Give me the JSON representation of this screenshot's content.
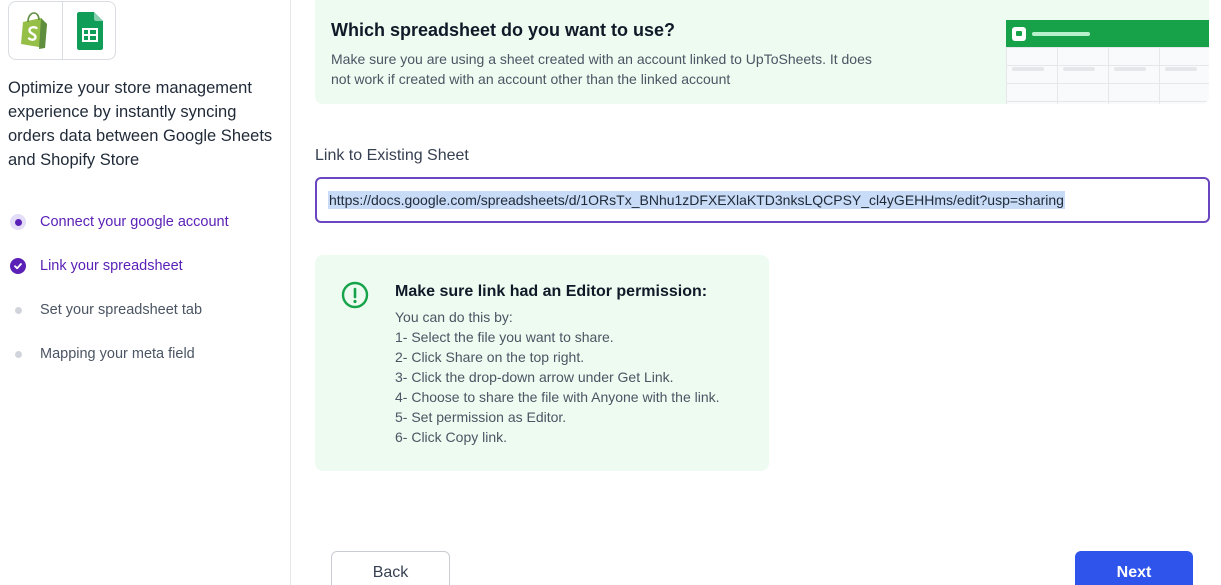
{
  "sidebar": {
    "description": "Optimize your store management experience by instantly syncing orders data between Google Sheets and Shopify Store",
    "steps": [
      {
        "label": "Connect your google account",
        "state": "active"
      },
      {
        "label": "Link your spreadsheet",
        "state": "done"
      },
      {
        "label": "Set your spreadsheet tab",
        "state": "pending"
      },
      {
        "label": "Mapping your meta field",
        "state": "pending"
      }
    ]
  },
  "banner": {
    "title": "Which spreadsheet do you want to use?",
    "text": "Make sure you are using a sheet created with an account linked to UpToSheets. It does not work if created with an account other than the linked account"
  },
  "link_field": {
    "label": "Link to Existing Sheet",
    "value": "https://docs.google.com/spreadsheets/d/1ORsTx_BNhu1zDFXEXlaKTD3nksLQCPSY_cl4yGEHHms/edit?usp=sharing"
  },
  "notice": {
    "title": "Make sure link had an Editor permission:",
    "lines": [
      "You can do this by:",
      "1- Select the file you want to share.",
      "2- Click Share on the top right.",
      "3- Click the drop-down arrow under Get Link.",
      "4- Choose to share the file with Anyone with the link.",
      "5- Set permission as Editor.",
      "6- Click Copy link."
    ]
  },
  "buttons": {
    "back": "Back",
    "next": "Next"
  },
  "colors": {
    "accent_purple": "#5b21b6",
    "primary_blue": "#2f54eb",
    "banner_green": "#edfbf1",
    "sheets_green": "#17a24a",
    "shopify_green": "#95bf47"
  },
  "icons": {
    "logo_left": "shopify-logo",
    "logo_right": "google-sheets-logo",
    "notice_icon": "exclamation-circle-icon"
  }
}
